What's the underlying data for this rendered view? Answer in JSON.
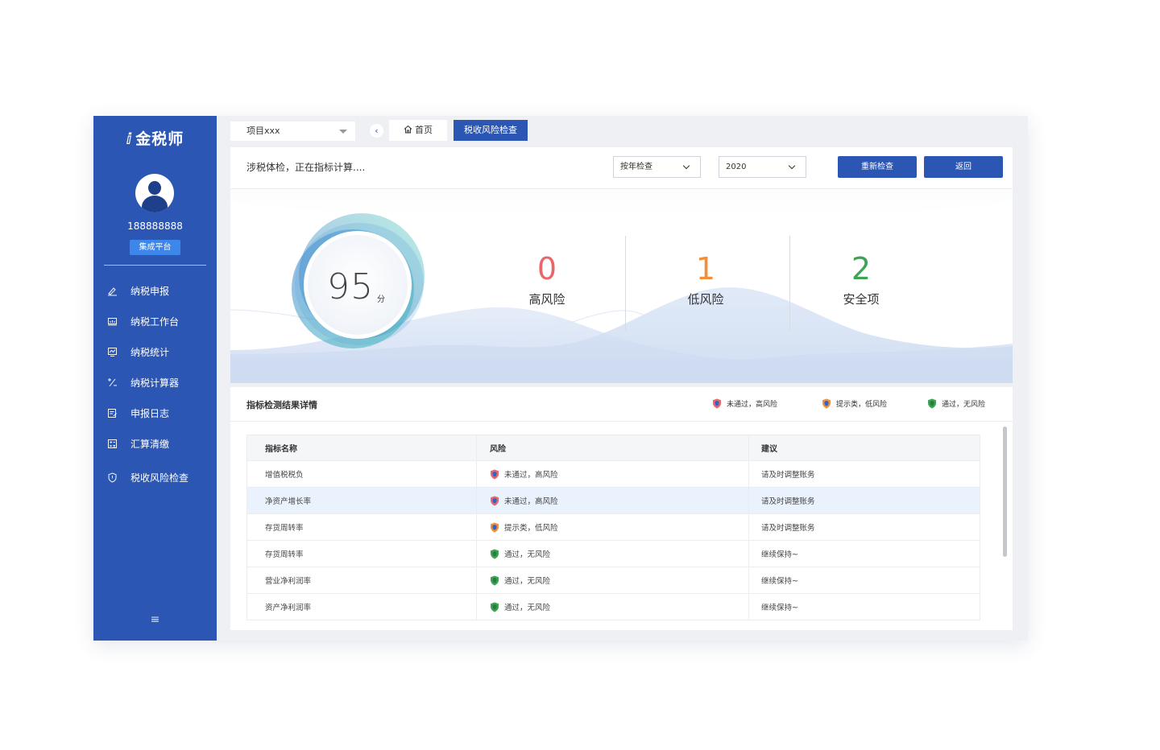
{
  "sidebar": {
    "logo": "金税师",
    "phone": "188888888",
    "platform_badge": "集成平台",
    "items": [
      {
        "label": "纳税申报",
        "icon": "edit-icon"
      },
      {
        "label": "纳税工作台",
        "icon": "workbench-icon"
      },
      {
        "label": "纳税统计",
        "icon": "statistics-icon"
      },
      {
        "label": "纳税计算器",
        "icon": "calculator-icon"
      },
      {
        "label": "申报日志",
        "icon": "log-icon"
      },
      {
        "label": "汇算清缴",
        "icon": "settlement-icon"
      },
      {
        "label": "税收风险检查",
        "icon": "shield-icon"
      }
    ]
  },
  "topbar": {
    "project": "项目xxx",
    "home_tab": "首页",
    "active_tab": "税收风险检查"
  },
  "check": {
    "status": "涉税体检，正在指标计算....",
    "mode_select": "按年检查",
    "year_select": "2020",
    "recheck_label": "重新检查",
    "back_label": "返回"
  },
  "score": {
    "value": "95",
    "unit": "分"
  },
  "stats": [
    {
      "value": "0",
      "label": "高风险",
      "color": "#e8676b"
    },
    {
      "value": "1",
      "label": "低风险",
      "color": "#f0903a"
    },
    {
      "value": "2",
      "label": "安全项",
      "color": "#3ba555"
    }
  ],
  "details": {
    "title": "指标检测结果详情",
    "legend": [
      {
        "label": "未通过，高风险",
        "color": "#e8676b"
      },
      {
        "label": "提示类，低风险",
        "color": "#f0903a"
      },
      {
        "label": "通过，无风险",
        "color": "#3ba555"
      }
    ],
    "columns": [
      "指标名称",
      "风险",
      "建议"
    ],
    "rows": [
      {
        "name": "增值税税负",
        "risk": "未通过，高风险",
        "level": "high",
        "advice": "请及时调整账务"
      },
      {
        "name": "净资产增长率",
        "risk": "未通过，高风险",
        "level": "high",
        "advice": "请及时调整账务"
      },
      {
        "name": "存货周转率",
        "risk": "提示类，低风险",
        "level": "low",
        "advice": "请及时调整账务"
      },
      {
        "name": "存货周转率",
        "risk": "通过，无风险",
        "level": "safe",
        "advice": "继续保持~"
      },
      {
        "name": "营业净利润率",
        "risk": "通过，无风险",
        "level": "safe",
        "advice": "继续保持~"
      },
      {
        "name": "资产净利润率",
        "risk": "通过，无风险",
        "level": "safe",
        "advice": "继续保持~"
      }
    ]
  },
  "colors": {
    "brand": "#2c56b4",
    "high": "#e8676b",
    "low": "#f0903a",
    "safe": "#3ba555"
  }
}
